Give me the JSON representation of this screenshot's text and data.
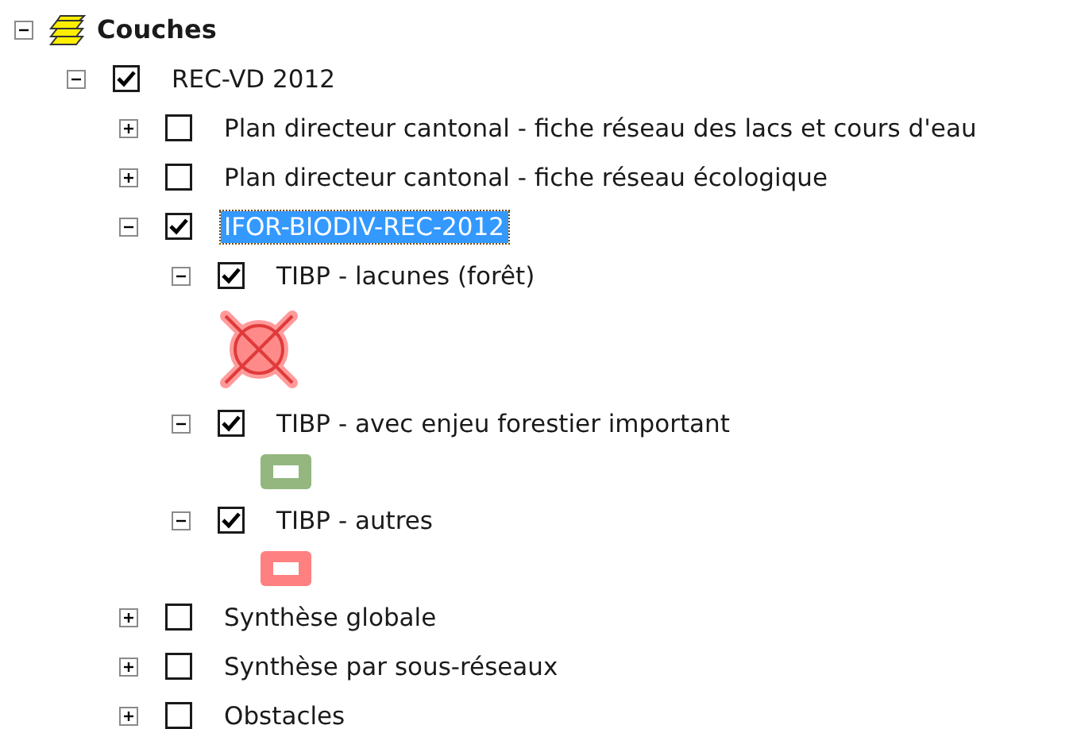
{
  "toc": {
    "title": "Couches",
    "expanded": true,
    "children": [
      {
        "label": "REC-VD 2012",
        "checked": true,
        "expanded": true,
        "selected": false,
        "children": [
          {
            "label": "Plan directeur cantonal - fiche réseau des lacs et cours d'eau",
            "checked": false,
            "expanded": false,
            "selected": false
          },
          {
            "label": "Plan directeur cantonal - fiche réseau écologique",
            "checked": false,
            "expanded": false,
            "selected": false
          },
          {
            "label": "IFOR-BIODIV-REC-2012",
            "checked": true,
            "expanded": true,
            "selected": true,
            "children": [
              {
                "label": "TIBP - lacunes (forêt)",
                "checked": true,
                "expanded": true,
                "selected": false,
                "symbol": {
                  "kind": "cross",
                  "color": "#e03a3a"
                }
              },
              {
                "label": "TIBP - avec enjeu forestier important",
                "checked": true,
                "expanded": true,
                "selected": false,
                "symbol": {
                  "kind": "fill",
                  "color": "#93b77f"
                }
              },
              {
                "label": "TIBP - autres",
                "checked": true,
                "expanded": true,
                "selected": false,
                "symbol": {
                  "kind": "fill",
                  "color": "#ff8080"
                }
              }
            ]
          },
          {
            "label": "Synthèse globale",
            "checked": false,
            "expanded": false,
            "selected": false
          },
          {
            "label": "Synthèse par sous-réseaux",
            "checked": false,
            "expanded": false,
            "selected": false
          },
          {
            "label": "Obstacles",
            "checked": false,
            "expanded": false,
            "selected": false
          }
        ]
      }
    ]
  }
}
